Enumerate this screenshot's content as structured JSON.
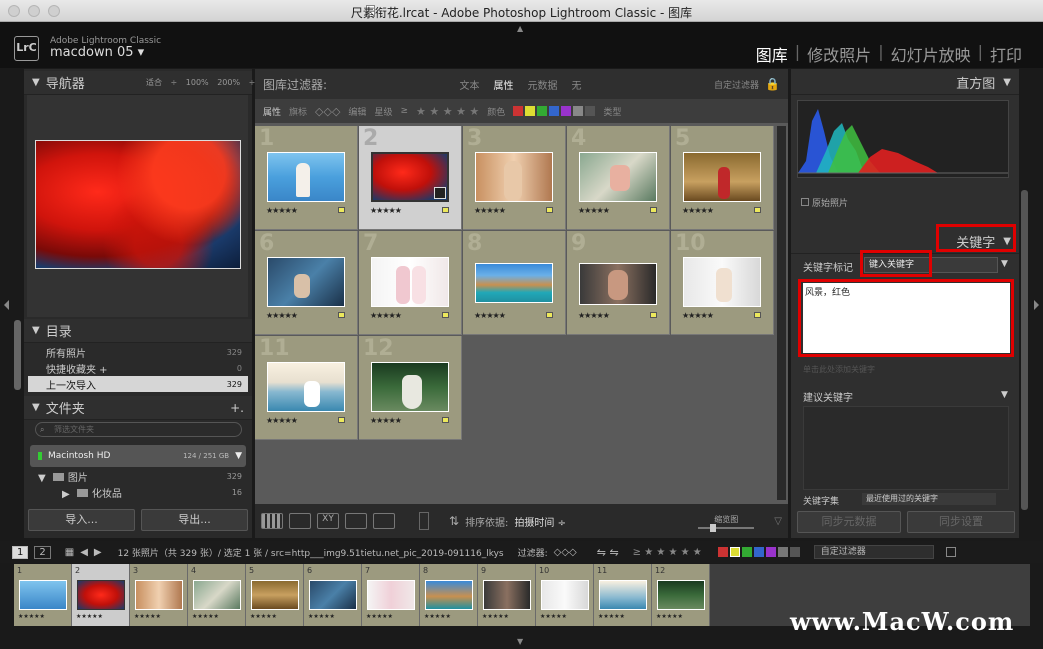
{
  "window": {
    "title": "尺素衔花.lrcat - Adobe Photoshop Lightroom Classic - 图库"
  },
  "identity": {
    "product": "Adobe Lightroom Classic",
    "user": "macdown 05",
    "logo": "LrC"
  },
  "modules": [
    "图库",
    "修改照片",
    "幻灯片放映",
    "打印"
  ],
  "navigator": {
    "title": "导航器",
    "options": "适合 ÷  100%  200% ÷"
  },
  "catalog": {
    "title": "目录",
    "items": [
      {
        "label": "所有照片",
        "count": "329"
      },
      {
        "label": "快捷收藏夹 +",
        "count": "0"
      },
      {
        "label": "上一次导入",
        "count": "329"
      }
    ]
  },
  "folders": {
    "title": "文件夹",
    "search_placeholder": "筛选文件夹",
    "volume": "Macintosh HD",
    "volume_size": "124 / 251 GB",
    "folder": "图片",
    "folder_count": "329",
    "subfolder": "化妆品",
    "subfolder_count": "16"
  },
  "left_buttons": {
    "import": "导入...",
    "export": "导出..."
  },
  "filter": {
    "title": "图库过滤器:",
    "tabs": [
      "文本",
      "属性",
      "元数据",
      "无"
    ],
    "preset": "自定过滤器",
    "bar_attr": "属性",
    "bar_flag": "旗标",
    "bar_edit": "编辑",
    "bar_rating": "星级",
    "bar_ge": "≥",
    "bar_color": "颜色",
    "bar_type": "类型"
  },
  "grid": {
    "cells": [
      {
        "num": "1",
        "stars": "★★★★★"
      },
      {
        "num": "2",
        "stars": "★★★★★"
      },
      {
        "num": "3",
        "stars": "★★★★★"
      },
      {
        "num": "4",
        "stars": "★★★★★"
      },
      {
        "num": "5",
        "stars": "★★★★★"
      },
      {
        "num": "6",
        "stars": "★★★★★"
      },
      {
        "num": "7",
        "stars": "★★★★★"
      },
      {
        "num": "8",
        "stars": "★★★★★"
      },
      {
        "num": "9",
        "stars": "★★★★★"
      },
      {
        "num": "10",
        "stars": "★★★★★"
      },
      {
        "num": "11",
        "stars": "★★★★★"
      },
      {
        "num": "12",
        "stars": "★★★★★"
      }
    ]
  },
  "toolbar": {
    "sort_label": "排序依据:",
    "sort_value": "拍摄时间 ÷",
    "thumb_label": "缩览图"
  },
  "histogram": {
    "title": "直方图",
    "original": "原始照片"
  },
  "keywords": {
    "title": "关键字",
    "tag_label": "关键字标记",
    "tag_select": "键入关键字",
    "text": "风景，红色",
    "hint": "单击此处添加关键字",
    "suggest_title": "建议关键字",
    "set_label": "关键字集",
    "set_value": "最近使用过的关键字"
  },
  "sync": {
    "metadata": "同步元数据",
    "settings": "同步设置"
  },
  "filmbar": {
    "page1": "1",
    "page2": "2",
    "info": "12 张照片（共 329 张）/ 选定 1 张 / src=http___img9.51tietu.net_pic_2019-091116_lkys",
    "filter_label": "过滤器:",
    "preset": "自定过滤器"
  },
  "filmstrip": {
    "items": [
      {
        "num": "1"
      },
      {
        "num": "2"
      },
      {
        "num": "3"
      },
      {
        "num": "4"
      },
      {
        "num": "5"
      },
      {
        "num": "6"
      },
      {
        "num": "7"
      },
      {
        "num": "8"
      },
      {
        "num": "9"
      },
      {
        "num": "10"
      },
      {
        "num": "11"
      },
      {
        "num": "12"
      }
    ]
  },
  "watermark": "www.MacW.com"
}
